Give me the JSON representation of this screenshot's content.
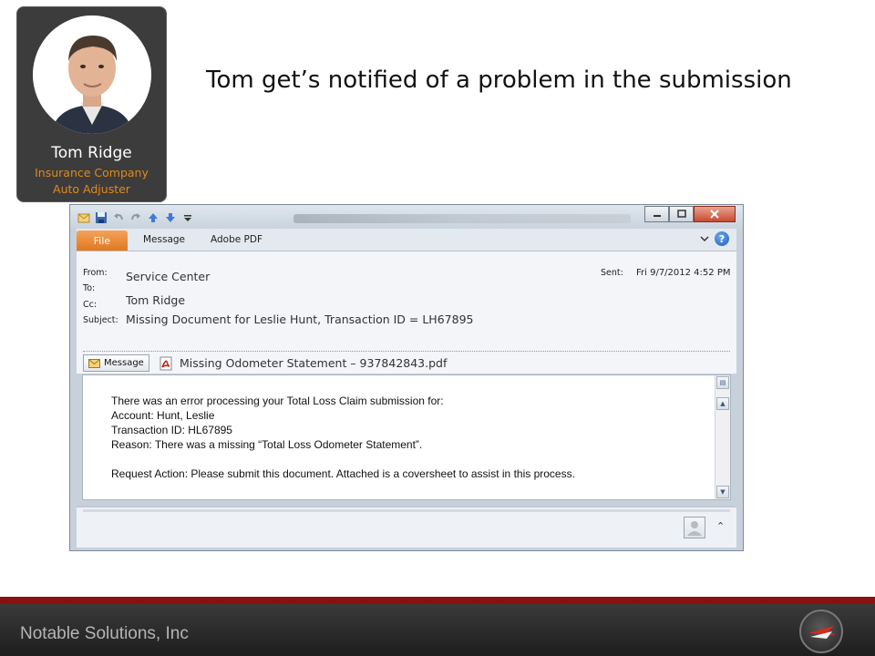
{
  "persona": {
    "name": "Tom Ridge",
    "role_line1": "Insurance Company",
    "role_line2": "Auto Adjuster"
  },
  "slide": {
    "title": "Tom get’s notified of a problem in the submission"
  },
  "email": {
    "tabs": {
      "file": "File",
      "message": "Message",
      "adobe": "Adobe PDF"
    },
    "labels": {
      "from": "From:",
      "to": "To:",
      "cc": "Cc:",
      "subject": "Subject:",
      "sent": "Sent:"
    },
    "from": "Service Center",
    "to": "Tom Ridge",
    "subject": "Missing Document for Leslie Hunt, Transaction ID = LH67895",
    "sent": "Fri 9/7/2012 4:52 PM",
    "message_tab": "Message",
    "attachment": "Missing Odometer Statement – 937842843.pdf",
    "body": {
      "line1": "There was an error processing your Total Loss Claim submission for:",
      "line2": "Account: Hunt, Leslie",
      "line3": "Transaction ID: HL67895",
      "line4": "Reason: There was a missing “Total Loss Odometer Statement”.",
      "line5": "",
      "line6": "Request Action: Please submit this document.  Attached is a coversheet to assist in this process."
    }
  },
  "footer": {
    "company": "Notable Solutions, Inc"
  },
  "colors": {
    "persona_bg": "#3c3c3c",
    "persona_role": "#e08a1c",
    "file_tab": "#e0781f",
    "footer_red": "#8b1012",
    "footer_bg": "#2a2a2a"
  },
  "icons": [
    "mail-icon",
    "save-icon",
    "undo-icon",
    "redo-icon",
    "up-arrow-icon",
    "down-arrow-icon",
    "customize-icon",
    "minimize-icon",
    "maximize-icon",
    "close-icon",
    "chevron-icon",
    "help-icon",
    "envelope-icon",
    "pdf-icon",
    "scroll-up-icon",
    "scroll-down-icon",
    "person-icon",
    "collapse-icon",
    "company-logo"
  ]
}
